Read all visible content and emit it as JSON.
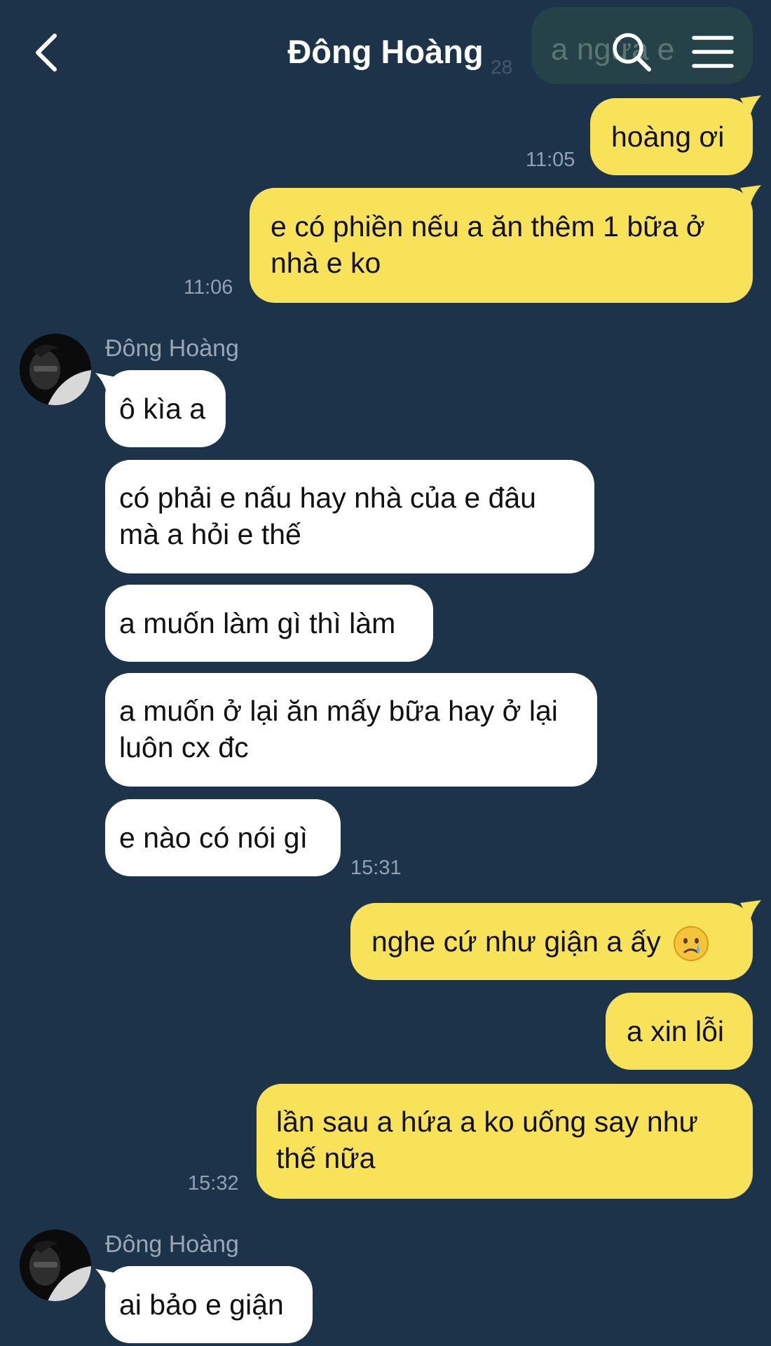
{
  "header": {
    "title": "Đông Hoàng",
    "back_icon": "chevron-left-icon",
    "search_icon": "search-icon",
    "menu_icon": "hamburger-menu-icon",
    "ghost_preview_text": "a ngừa e",
    "ghost_preview_time": "28"
  },
  "colors": {
    "background": "#1d3349",
    "outgoing_bubble": "#f7e25a",
    "incoming_bubble": "#ffffff",
    "timestamp": "#93a2b2"
  },
  "messages": [
    {
      "id": "m1",
      "from": "me",
      "text": "hoàng ơi",
      "time": "11:05"
    },
    {
      "id": "m2",
      "from": "me",
      "lines": [
        "e có phiền nếu a ăn thêm 1 bữa ở",
        "nhà e ko"
      ],
      "time": "11:06"
    },
    {
      "id": "m3",
      "from": "them",
      "sender": "Đông Hoàng",
      "text": "ô kìa a"
    },
    {
      "id": "m4",
      "from": "them",
      "lines": [
        "có phải e nấu hay nhà của e đâu",
        "mà a hỏi e thế"
      ]
    },
    {
      "id": "m5",
      "from": "them",
      "text": "a muốn làm gì thì làm"
    },
    {
      "id": "m6",
      "from": "them",
      "lines": [
        "a muốn ở lại ăn mấy bữa hay ở lại",
        "luôn cx đc"
      ]
    },
    {
      "id": "m7",
      "from": "them",
      "text": "e nào có nói gì",
      "time": "15:31"
    },
    {
      "id": "m8",
      "from": "me",
      "text": "nghe cứ như giận a ấy",
      "emoji": "crying-face-emoji"
    },
    {
      "id": "m9",
      "from": "me",
      "text": "a xin lỗi"
    },
    {
      "id": "m10",
      "from": "me",
      "lines": [
        "lần sau a hứa a ko uống say như",
        "thế nữa"
      ],
      "time": "15:32"
    },
    {
      "id": "m11",
      "from": "them",
      "sender": "Đông Hoàng",
      "text": "ai bảo e giận"
    }
  ]
}
